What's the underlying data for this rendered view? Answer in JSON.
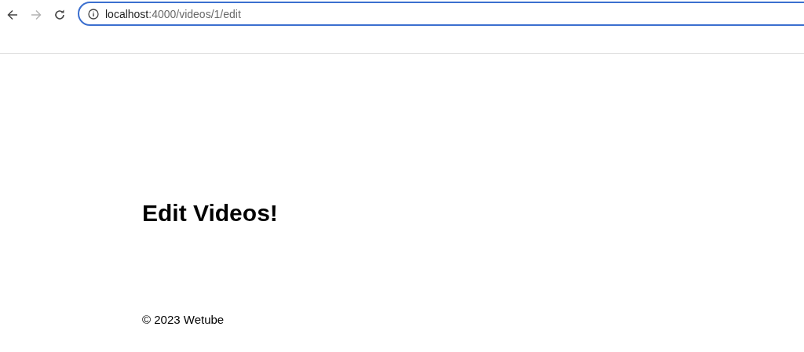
{
  "toolbar": {
    "nav_buttons": [
      {
        "kind": "back",
        "disabled": false
      },
      {
        "kind": "forward",
        "disabled": true
      },
      {
        "kind": "reload",
        "disabled": false
      }
    ],
    "address_bar": {
      "host": "localhost",
      "path": ":4000/videos/1/edit",
      "focused": true
    }
  },
  "page": {
    "heading": "Edit Videos!",
    "footer": "© 2023 Wetube"
  }
}
